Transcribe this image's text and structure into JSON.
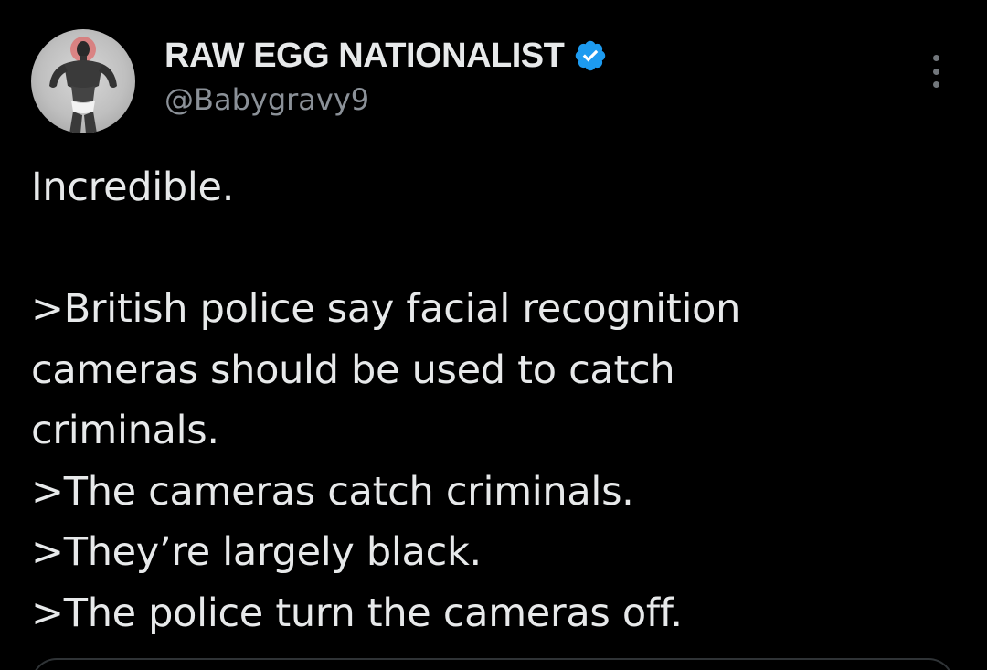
{
  "author": {
    "display_name": "RAW EGG NATIONALIST",
    "handle": "@Babygravy9",
    "verified": true,
    "avatar_icon": "bodybuilder-avatar-icon"
  },
  "menu": {
    "more_icon": "more-options-icon"
  },
  "tweet": {
    "lines": [
      "Incredible.",
      "",
      ">British police say facial recognition",
      "cameras should be used to catch",
      "criminals.",
      ">The cameras catch criminals.",
      ">They’re largely black.",
      ">The police turn the cameras off."
    ]
  },
  "colors": {
    "background": "#000000",
    "text_primary": "#e7e9ea",
    "text_secondary": "#8b9198",
    "verified_blue": "#1d9bf0",
    "border": "#2f3336"
  }
}
